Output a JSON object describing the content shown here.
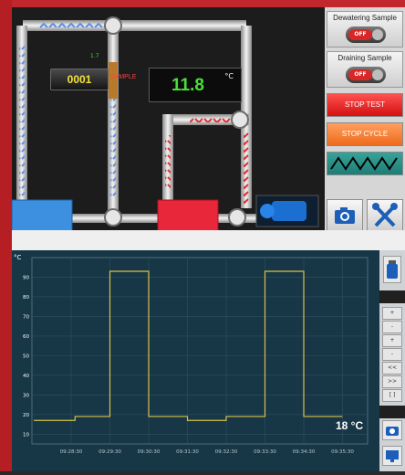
{
  "process": {
    "counter_value": "0001",
    "counter_label": "1.7",
    "sample_label": "SAMPLE",
    "temperature_value": "11.8",
    "temperature_unit": "°C"
  },
  "controls": {
    "dewatering_title": "Dewatering Sample",
    "dewatering_state": "OFF",
    "draining_title": "Draining Sample",
    "draining_state": "OFF",
    "stop_test_label": "STOP TEST",
    "stop_cycle_label": "STOP CYCLE"
  },
  "chart_data": {
    "type": "line",
    "ylabel": "°C",
    "yticks": [
      10,
      20,
      30,
      40,
      50,
      60,
      70,
      80,
      90
    ],
    "ylim": [
      5,
      100
    ],
    "xticks": [
      "09:28:30",
      "09:29:30",
      "09:30:30",
      "09:31:30",
      "09:32:30",
      "09:33:30",
      "09:34:30",
      "09:35:30"
    ],
    "series": [
      {
        "color": "#d9c24a",
        "points": [
          [
            0,
            17
          ],
          [
            1.05,
            17
          ],
          [
            1.05,
            19
          ],
          [
            2.0,
            19
          ],
          [
            2.0,
            93
          ],
          [
            3.0,
            93
          ],
          [
            3.0,
            19
          ],
          [
            4.0,
            19
          ],
          [
            4.0,
            17
          ],
          [
            5.0,
            17
          ],
          [
            5.0,
            19
          ],
          [
            6.0,
            19
          ],
          [
            6.0,
            93
          ],
          [
            7.0,
            93
          ],
          [
            7.0,
            19
          ],
          [
            8.0,
            19
          ]
        ]
      }
    ],
    "current_value_label": "18 °C",
    "grid": true
  },
  "side_panel": {
    "buttons": [
      "+",
      "-",
      "+",
      "-",
      "<<",
      ">>",
      "[ ]"
    ]
  },
  "colors": {
    "accent_red": "#b51f24",
    "line": "#d9c24a",
    "display_green": "#4cdd3c"
  }
}
